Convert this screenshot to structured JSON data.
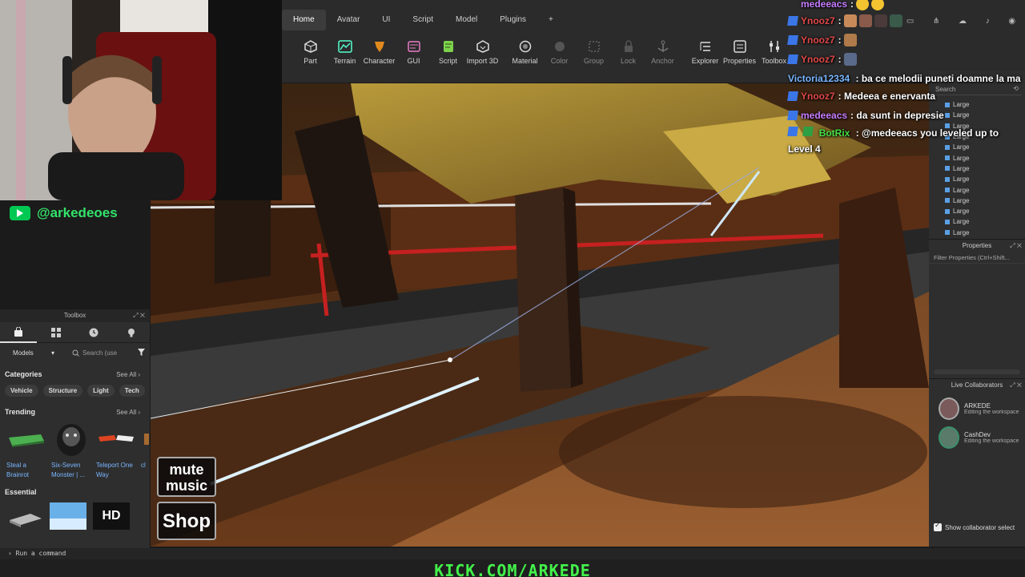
{
  "ribbon": {
    "tabs": [
      "Home",
      "Avatar",
      "UI",
      "Script",
      "Model",
      "Plugins",
      "+"
    ],
    "tools": [
      {
        "label": "Part",
        "icon": "part-icon"
      },
      {
        "label": "Terrain",
        "icon": "terrain-icon"
      },
      {
        "label": "Character",
        "icon": "character-icon"
      },
      {
        "label": "GUI",
        "icon": "gui-icon"
      },
      {
        "label": "Script",
        "icon": "script-icon"
      },
      {
        "label": "Import 3D",
        "icon": "import-3d-icon"
      },
      {
        "label": "Material",
        "icon": "material-icon"
      },
      {
        "label": "Color",
        "icon": "color-icon"
      },
      {
        "label": "Group",
        "icon": "group-icon"
      },
      {
        "label": "Lock",
        "icon": "lock-icon"
      },
      {
        "label": "Anchor",
        "icon": "anchor-icon"
      },
      {
        "label": "Explorer",
        "icon": "explorer-icon"
      },
      {
        "label": "Properties",
        "icon": "properties-icon"
      },
      {
        "label": "Toolbox",
        "icon": "toolbox-icon"
      }
    ]
  },
  "channel": {
    "handle": "@arkedeoes"
  },
  "toolbox": {
    "title": "Toolbox",
    "dropdown": "Models",
    "search_placeholder": "Search (use",
    "categories_title": "Categories",
    "see_all": "See All",
    "categories": [
      "Vehicle",
      "Structure",
      "Light",
      "Tech"
    ],
    "trending_title": "Trending",
    "trending": [
      {
        "name": "Steal a Brainrot"
      },
      {
        "name": "Six-Seven Monster | ..."
      },
      {
        "name": "Teleport One Way"
      },
      {
        "name": "cl"
      }
    ],
    "essential_title": "Essential",
    "hd_label": "HD"
  },
  "explorer": {
    "search_placeholder": "Search",
    "items": [
      "Large",
      "Large",
      "Large",
      "Large",
      "Large",
      "Large",
      "Large",
      "Large",
      "Large",
      "Large",
      "Large",
      "Large",
      "Large"
    ]
  },
  "properties": {
    "title": "Properties",
    "filter_placeholder": "Filter Properties (Ctrl+Shift..."
  },
  "collaborators": {
    "title": "Live Collaborators",
    "users": [
      {
        "name": "ARKEDE",
        "status": "Editing the workspace"
      },
      {
        "name": "CashDev",
        "status": "Editing the workspace"
      }
    ],
    "show_select": "Show collaborator select"
  },
  "chat": [
    {
      "user": "medeeacs",
      "text": "",
      "user_color": "#c77dff"
    },
    {
      "user": "Ynooz7",
      "text": "",
      "user_color": "#e04848"
    },
    {
      "user": "Ynooz7",
      "text": "",
      "user_color": "#e04848"
    },
    {
      "user": "Ynooz7",
      "text": "",
      "user_color": "#e04848"
    },
    {
      "user": "Victoria12334",
      "text": ": ba ce melodii puneti doamne la ma",
      "user_color": "#7ab6ff"
    },
    {
      "user": "Ynooz7",
      "text": ": Medeea e enervanta",
      "user_color": "#e04848"
    },
    {
      "user": "medeeacs",
      "text": ": da sunt in depresie",
      "user_color": "#c77dff"
    },
    {
      "user": "BotRix",
      "text": ": @medeeacs you leveled up to Level 4",
      "user_color": "#46e046"
    }
  ],
  "hud": {
    "mute": "mute music",
    "shop": "Shop"
  },
  "command": {
    "placeholder": "Run a command"
  },
  "footer": {
    "kick": "KICK.COM/ARKEDE"
  },
  "colors": {
    "accent_green": "#43f24a",
    "ribbon_bg": "#2b2b2b",
    "panel_bg": "#2e2e2e"
  }
}
